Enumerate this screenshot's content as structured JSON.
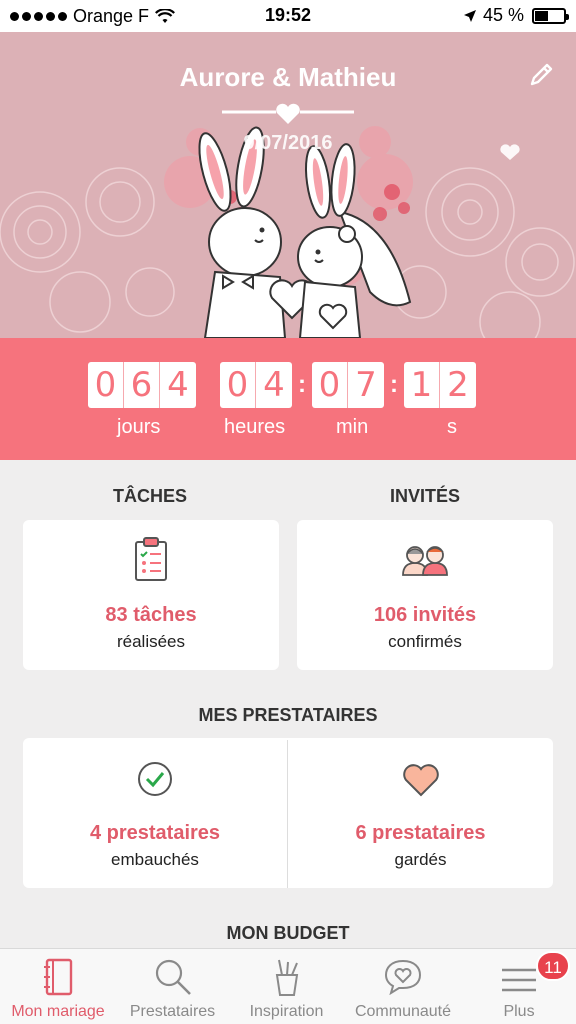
{
  "status_bar": {
    "carrier": "Orange F",
    "time": "19:52",
    "battery": "45 %",
    "battery_level": 0.45
  },
  "hero": {
    "couple_name": "Aurore & Mathieu",
    "date": "9/07/2016"
  },
  "countdown": {
    "days": [
      "0",
      "6",
      "4"
    ],
    "hours": [
      "0",
      "4"
    ],
    "minutes": [
      "0",
      "7"
    ],
    "seconds": [
      "1",
      "2"
    ],
    "labels": {
      "days": "jours",
      "hours": "heures",
      "minutes": "min",
      "seconds": "s"
    },
    "accent": "#f6737d"
  },
  "tasks": {
    "title": "TÂCHES",
    "count": "83 tâches",
    "sub": "réalisées"
  },
  "guests": {
    "title": "INVITÉS",
    "count": "106 invités",
    "sub": "confirmés"
  },
  "vendors": {
    "title": "MES PRESTATAIRES",
    "hired": {
      "count": "4 prestataires",
      "sub": "embauchés"
    },
    "saved": {
      "count": "6 prestataires",
      "sub": "gardés"
    }
  },
  "budget": {
    "title": "MON BUDGET"
  },
  "tabbar": {
    "items": [
      {
        "label": "Mon mariage",
        "icon": "notebook-icon",
        "active": true
      },
      {
        "label": "Prestataires",
        "icon": "search-icon"
      },
      {
        "label": "Inspiration",
        "icon": "brushes-cup-icon"
      },
      {
        "label": "Communauté",
        "icon": "chat-heart-icon"
      },
      {
        "label": "Plus",
        "icon": "menu-icon",
        "badge": "11"
      }
    ]
  }
}
